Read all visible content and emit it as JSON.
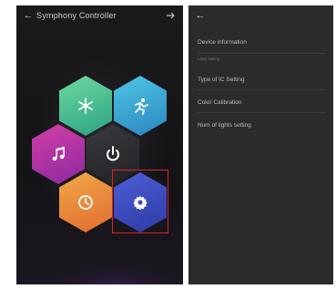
{
  "left_screen": {
    "title": "Symphony Controller",
    "tiles": [
      {
        "id": "color",
        "icon": "snowflake-icon",
        "color": "#3bbf8f"
      },
      {
        "id": "effects",
        "icon": "figure-icon",
        "color": "#3ba6d6"
      },
      {
        "id": "music",
        "icon": "music-note-icon",
        "color": "#c03aa5"
      },
      {
        "id": "power",
        "icon": "power-icon",
        "color": "#2f2f33"
      },
      {
        "id": "timer",
        "icon": "clock-icon",
        "color": "#ea8a3a"
      },
      {
        "id": "settings",
        "icon": "gear-icon",
        "color": "#3f4fc4"
      }
    ],
    "highlight_color": "#d8232a"
  },
  "right_screen": {
    "items": [
      {
        "label": "Device information"
      },
      {
        "section": "Lamp setting"
      },
      {
        "label": "Type of IC Setting"
      },
      {
        "label": "Color Calibration"
      },
      {
        "label": "Num of lights setting"
      }
    ]
  }
}
